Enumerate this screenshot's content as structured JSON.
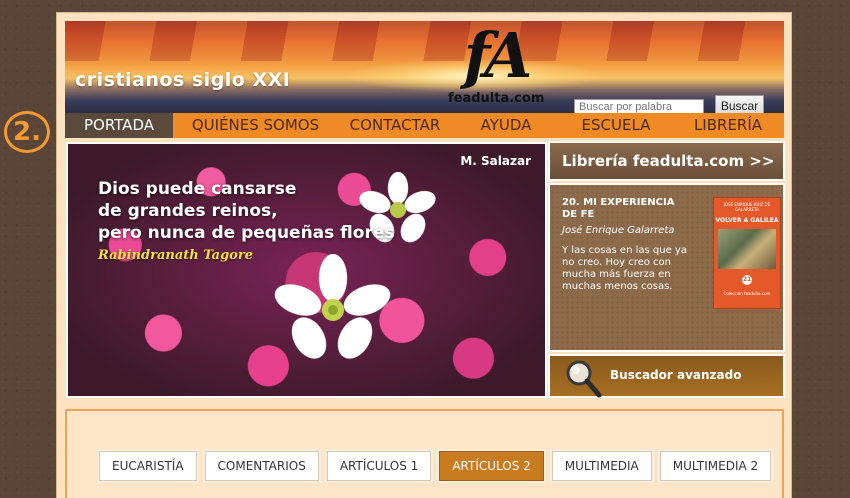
{
  "step_badge": "2.",
  "header": {
    "site_title": "cristianos siglo XXI",
    "logo_mark": "fA",
    "logo_name": "feadulta.com",
    "search_placeholder": "Buscar por palabra",
    "search_button": "Buscar"
  },
  "nav": {
    "items": [
      {
        "label": "PORTADA",
        "active": true
      },
      {
        "label": "QUIÉNES SOMOS",
        "active": false
      },
      {
        "label": "CONTACTAR",
        "active": false
      },
      {
        "label": "AYUDA",
        "active": false
      },
      {
        "label": "ESCUELA",
        "active": false
      },
      {
        "label": "LIBRERÍA",
        "active": false
      }
    ]
  },
  "hero": {
    "credit": "M. Salazar",
    "quote_lines": [
      "Dios puede cansarse",
      "de grandes reinos,",
      "pero nunca de pequeñas flores"
    ],
    "author": "Rabindranath Tagore"
  },
  "sidebar": {
    "libreria_link": "Librería feadulta.com >>",
    "book": {
      "title": "20. MI EXPERIENCIA DE FE",
      "author": "José Enrique Galarreta",
      "description": "Y las cosas en las que ya no creo. Hoy creo con mucha más fuerza en muchas menos cosas.",
      "cover_author": "JOSÉ ENRIQUE RUIZ DE GALARRETA",
      "cover_title": "VOLVER A GALILEA",
      "cover_number": "21",
      "cover_publisher": "Colección feadulta.com"
    },
    "advanced_search": "Buscador avanzado"
  },
  "tabs": [
    {
      "label": "EUCARISTÍA",
      "active": false
    },
    {
      "label": "COMENTARIOS",
      "active": false
    },
    {
      "label": "ARTÍCULOS 1",
      "active": false
    },
    {
      "label": "ARTÍCULOS 2",
      "active": true
    },
    {
      "label": "MULTIMEDIA",
      "active": false
    },
    {
      "label": "MULTIMEDIA 2",
      "active": false
    }
  ],
  "colors": {
    "nav_orange": "#f08a25",
    "nav_active": "#5a4a3c",
    "tab_active": "#c97b1f",
    "accent_badge": "#f39a32"
  }
}
